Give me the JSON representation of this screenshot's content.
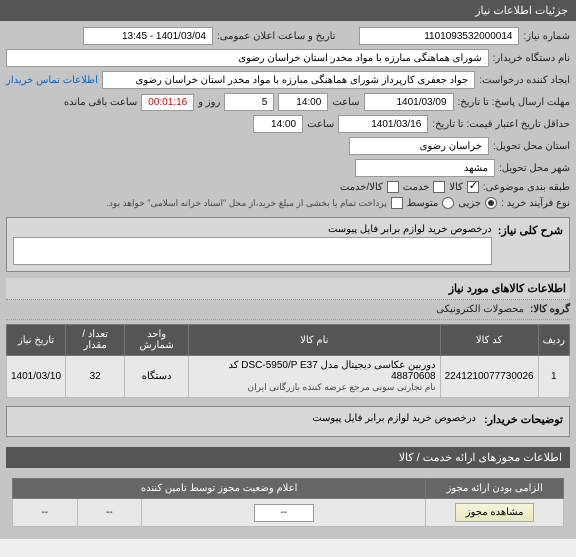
{
  "header": {
    "title": "جزئیات اطلاعات نیاز"
  },
  "form": {
    "need_number_label": "شماره نیاز:",
    "need_number": "1101093532000014",
    "announce_label": "تاریخ و ساعت اعلان عمومی:",
    "announce_value": "1401/03/04 - 13:45",
    "buyer_label": "نام دستگاه خریدار:",
    "buyer_value": "شورای هماهنگی مبارزه با مواد مخدر استان خراسان رضوی",
    "creator_label": "ایجاد کننده درخواست:",
    "creator_value": "جواد جعفری کارپرداز شورای هماهنگی مبارزه با مواد مخدر استان خراسان رضوی",
    "contact_link": "اطلاعات تماس خریدار",
    "deadline_label": "مهلت ارسال پاسخ: تا تاریخ:",
    "deadline_date": "1401/03/09",
    "time_label": "ساعت",
    "deadline_time": "14:00",
    "days_remain": "5",
    "days_label": "روز و",
    "countdown": "00:01:16",
    "countdown_label": "ساعت باقی مانده",
    "min_valid_label": "حداقل تاریخ اعتبار قیمت: تا تاریخ:",
    "min_valid_date": "1401/03/16",
    "min_valid_time": "14:00",
    "province_label": "استان محل تحویل:",
    "province": "خراسان رضوی",
    "city_label": "شهر محل تحویل:",
    "city": "مشهد",
    "class_label": "طبقه بندی موضوعی:",
    "opt_kala": "کالا",
    "opt_service": "خدمت",
    "opt_kalaservice": "کالا/خدمت",
    "buy_type_label": "نوع فرآیند خرید :",
    "opt_partial": "جزیی",
    "opt_medium": "متوسط",
    "buy_note": "پرداخت تمام یا بخشی از مبلغ خرید،از محل \"اسناد خزانه اسلامی\" خواهد بود."
  },
  "desc": {
    "title": "شرح کلی نیاز:",
    "text": "درخصوص خرید لوازم برابر فایل پیوست"
  },
  "goods": {
    "header": "اطلاعات کالاهای مورد نیاز",
    "group_label": "گروه کالا:",
    "group_value": "محصولات الکترونیکی",
    "cols": {
      "row": "ردیف",
      "code": "کد کالا",
      "name": "نام کالا",
      "unit": "واحد شمارش",
      "qty": "تعداد / مقدار",
      "date": "تاریخ نیاز"
    },
    "item": {
      "row": "1",
      "code": "2241210077730026",
      "name": "دوربین عکاسی دیجیتال مدل DSC-5950/P E37 کد 48870608",
      "name2": "نام تجارتی سونی مرجع عرضه کننده بازرگانی ایران",
      "unit": "دستگاه",
      "qty": "32",
      "date": "1401/03/10"
    }
  },
  "buyer_note": {
    "label": "توضیحات خریدار:",
    "text": "درخصوص خرید لوازم برابر فایل پیوست"
  },
  "license": {
    "header": "اطلاعات مجوزهای ارائه خدمت / کالا",
    "status_header": "اعلام وضعیت مجوز توسط تامین کننده",
    "mandatory": "الزامی بودن ارائه مجوز",
    "view_btn": "مشاهده مجوز",
    "dash": "--"
  }
}
